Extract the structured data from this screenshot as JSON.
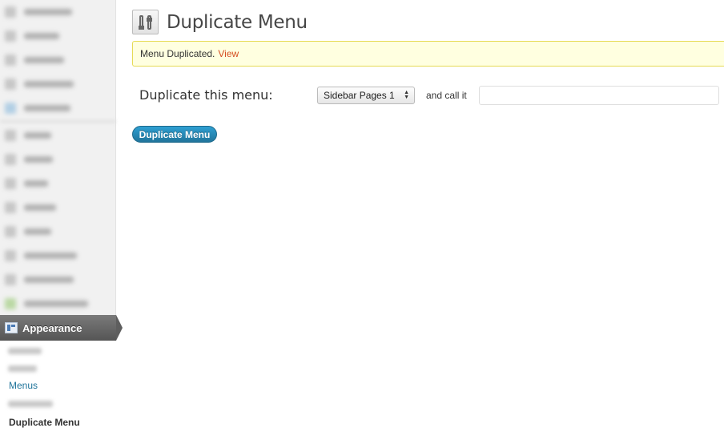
{
  "sidebar": {
    "active_section_label": "Appearance",
    "active_section_icon": "appearance-icon",
    "submenu": {
      "menus_label": "Menus",
      "current_label": "Duplicate Menu"
    }
  },
  "header": {
    "title": "Duplicate Menu",
    "icon": "tools-icon"
  },
  "notice": {
    "message": "Menu Duplicated.",
    "link_label": "View"
  },
  "form": {
    "duplicate_label": "Duplicate this menu:",
    "selected_menu": "Sidebar Pages 1",
    "call_it_label": "and call it",
    "new_name_value": "",
    "submit_label": "Duplicate Menu"
  },
  "colors": {
    "link": "#21759b",
    "notice_bg": "#ffffe0",
    "notice_link": "#d54e21",
    "button": "#21759b"
  }
}
